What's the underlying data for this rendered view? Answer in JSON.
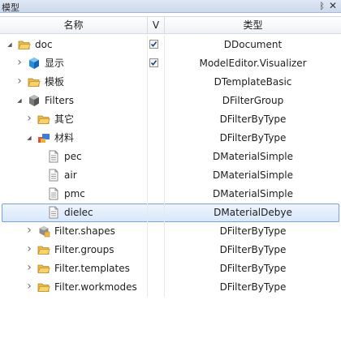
{
  "panel": {
    "title": "模型",
    "pin_glyph": "ᛒ",
    "close_glyph": "✕"
  },
  "columns": {
    "name": "名称",
    "visible": "V",
    "type": "类型"
  },
  "rows": [
    {
      "name": "doc",
      "type": "DDocument",
      "depth": 0,
      "expander": "expanded",
      "icon": "folder-open-icon",
      "checked": true
    },
    {
      "name": "显示",
      "type": "ModelEditor.Visualizer",
      "depth": 1,
      "expander": "collapsed",
      "icon": "cube-icon",
      "checked": true
    },
    {
      "name": "模板",
      "type": "DTemplateBasic",
      "depth": 1,
      "expander": "collapsed",
      "icon": "folder-open-icon"
    },
    {
      "name": "Filters",
      "type": "DFilterGroup",
      "depth": 1,
      "expander": "expanded",
      "icon": "gray-cube-icon"
    },
    {
      "name": "其它",
      "type": "DFilterByType",
      "depth": 2,
      "expander": "collapsed",
      "icon": "folder-open-icon"
    },
    {
      "name": "材料",
      "type": "DFilterByType",
      "depth": 2,
      "expander": "expanded",
      "icon": "materials-icon"
    },
    {
      "name": "pec",
      "type": "DMaterialSimple",
      "depth": 3,
      "expander": "none",
      "icon": "document-icon"
    },
    {
      "name": "air",
      "type": "DMaterialSimple",
      "depth": 3,
      "expander": "none",
      "icon": "document-icon"
    },
    {
      "name": "pmc",
      "type": "DMaterialSimple",
      "depth": 3,
      "expander": "none",
      "icon": "document-icon"
    },
    {
      "name": "dielec",
      "type": "DMaterialDebye",
      "depth": 3,
      "expander": "none",
      "icon": "document-icon",
      "selected": true
    },
    {
      "name": "Filter.shapes",
      "type": "DFilterByType",
      "depth": 2,
      "expander": "collapsed",
      "icon": "shapes-icon"
    },
    {
      "name": "Filter.groups",
      "type": "DFilterByType",
      "depth": 2,
      "expander": "collapsed",
      "icon": "folder-open-icon"
    },
    {
      "name": "Filter.templates",
      "type": "DFilterByType",
      "depth": 2,
      "expander": "collapsed",
      "icon": "folder-open-icon"
    },
    {
      "name": "Filter.workmodes",
      "type": "DFilterByType",
      "depth": 2,
      "expander": "collapsed",
      "icon": "folder-open-icon"
    }
  ]
}
